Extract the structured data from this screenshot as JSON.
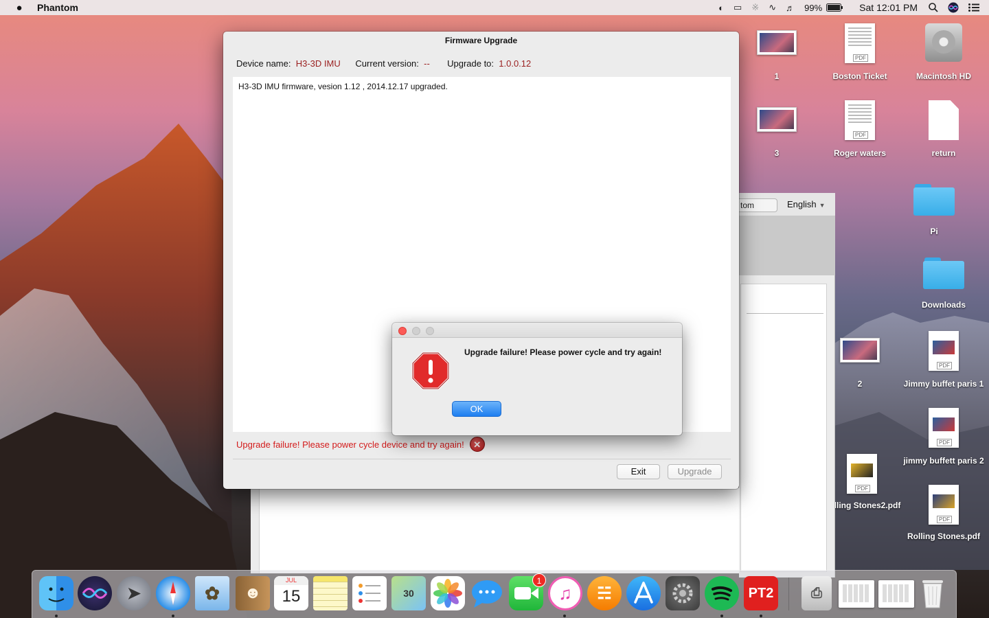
{
  "menubar": {
    "app_name": "Phantom",
    "battery_percent": "99%",
    "clock": "Sat 12:01 PM",
    "icons": [
      "apple-icon",
      "vpn-icon",
      "airplay-icon",
      "bluetooth-icon",
      "wifi-icon",
      "volume-icon",
      "battery-icon",
      "spotlight-icon",
      "siri-icon",
      "notification-center-icon"
    ]
  },
  "desktop": {
    "icons": [
      {
        "label": "1",
        "type": "screenshot"
      },
      {
        "label": "Boston Ticket",
        "type": "pdf",
        "badge": "PDF"
      },
      {
        "label": "Macintosh HD",
        "type": "drive"
      },
      {
        "label": "3",
        "type": "screenshot"
      },
      {
        "label": "Roger waters",
        "type": "pdf",
        "badge": "PDF"
      },
      {
        "label": "return",
        "type": "blank-document"
      },
      {
        "label": "Pi",
        "type": "folder"
      },
      {
        "label": "Downloads",
        "type": "folder"
      },
      {
        "label": "2",
        "type": "screenshot"
      },
      {
        "label": "Jimmy buffet paris 1",
        "type": "pdf",
        "badge": "PDF"
      },
      {
        "label": "jimmy buffett paris 2",
        "type": "pdf",
        "badge": "PDF"
      },
      {
        "label": "Rolling Stones2.pdf",
        "type": "pdf",
        "badge": "PDF"
      },
      {
        "label": "Rolling Stones.pdf",
        "type": "pdf",
        "badge": "PDF"
      }
    ]
  },
  "background_window": {
    "tab_label": "tom",
    "language": "English"
  },
  "firmware_window": {
    "title": "Firmware Upgrade",
    "device_name_label": "Device name:",
    "device_name_value": "H3-3D IMU",
    "current_version_label": "Current version:",
    "current_version_value": "--",
    "upgrade_to_label": "Upgrade to:",
    "upgrade_to_value": "1.0.0.12",
    "log_text": "H3-3D IMU firmware, vesion 1.12 , 2014.12.17 upgraded.",
    "error_text": "Upgrade failure! Please power cycle device and try again!",
    "exit_label": "Exit",
    "upgrade_label": "Upgrade"
  },
  "alert": {
    "message": "Upgrade failure! Please power cycle and try again!",
    "ok_label": "OK"
  },
  "dock": {
    "apps": [
      "Finder",
      "Siri",
      "Launchpad",
      "Safari",
      "Mail",
      "Contacts",
      "Calendar",
      "Notes",
      "Reminders",
      "Maps",
      "Photos",
      "Messages",
      "FaceTime",
      "iTunes",
      "iBooks",
      "App Store",
      "System Preferences",
      "Spotify",
      "PT2"
    ],
    "calendar_month": "JUL",
    "calendar_day": "15",
    "facetime_badge": "1",
    "pt2_label": "PT2",
    "colors": {
      "pt2": "#e0201f",
      "spotify": "#1db954",
      "messages": "#2f9bf5"
    }
  }
}
